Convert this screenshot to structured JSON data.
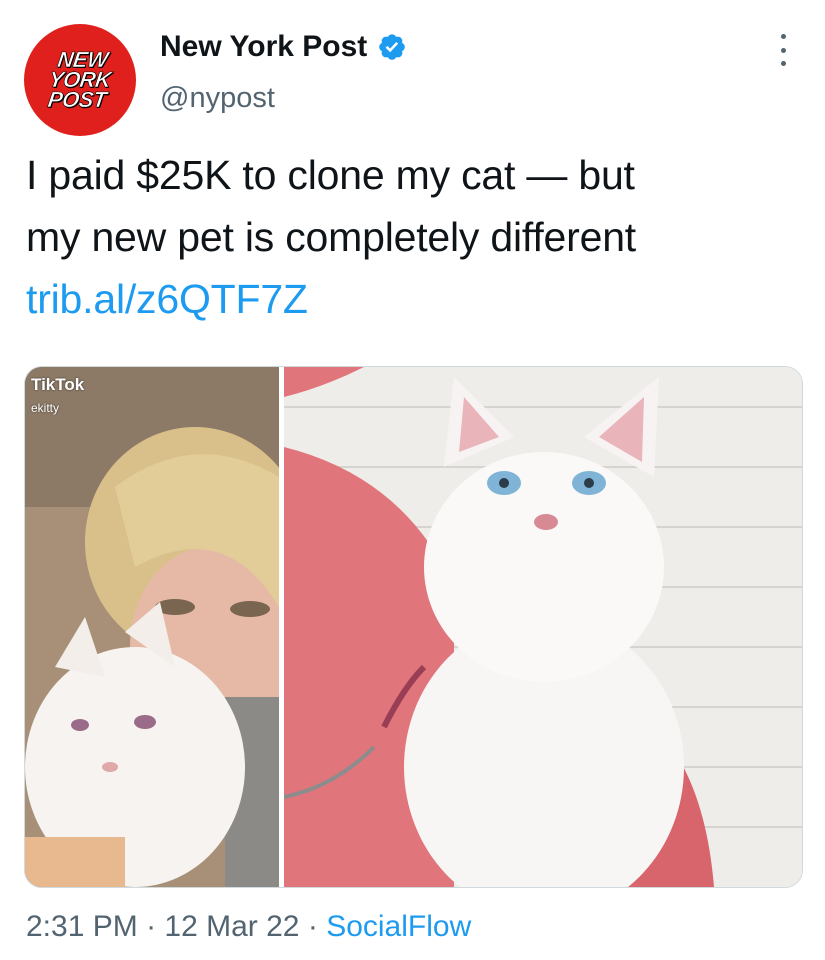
{
  "account": {
    "display_name": "New York Post",
    "handle": "@nypost",
    "avatar_text": [
      "NEW",
      "YORK",
      "POST"
    ],
    "verified": true
  },
  "tweet": {
    "text_lines": [
      "I paid $25K to clone my cat — but",
      "my new pet is completely different"
    ],
    "link": "trib.al/z6QTF7Z"
  },
  "media": {
    "left_overlay_app": "TikTok",
    "left_overlay_user": "ekitty"
  },
  "footer": {
    "time": "2:31 PM",
    "separator": "·",
    "date": "12 Mar 22",
    "source": "SocialFlow"
  },
  "colors": {
    "link": "#1d9bf0",
    "secondary_text": "#536471",
    "avatar_bg": "#e0201c"
  },
  "icons": [
    "verified-badge-icon",
    "more-options-icon"
  ]
}
